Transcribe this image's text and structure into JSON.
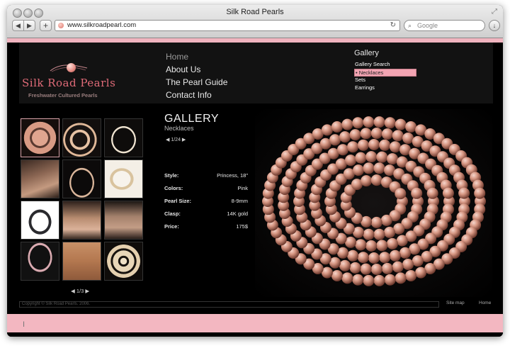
{
  "window": {
    "title": "Silk Road Pearls"
  },
  "browser": {
    "url": "www.silkroadpearl.com",
    "search_placeholder": "Google",
    "back_icon": "back-arrow-icon",
    "forward_icon": "forward-arrow-icon",
    "add_icon": "plus-icon",
    "reload_icon": "reload-icon"
  },
  "site": {
    "logo_text": "Silk Road Pearls",
    "tagline": "Freshwater Cultured Pearls",
    "nav": [
      {
        "label": "Home"
      },
      {
        "label": "About Us"
      },
      {
        "label": "The Pearl Guide"
      },
      {
        "label": "Contact Info"
      }
    ],
    "subnav": {
      "title": "Gallery",
      "items": [
        {
          "label": "Gallery Search"
        },
        {
          "label": "• Necklaces"
        },
        {
          "label": "Sets"
        },
        {
          "label": "Earrings"
        }
      ]
    }
  },
  "gallery": {
    "title": "GALLERY",
    "subtitle": "Necklaces",
    "counter": "1/24",
    "thumb_pager": "1/3",
    "specs": [
      {
        "label": "Style:",
        "value": "Princess, 18\""
      },
      {
        "label": "Colors:",
        "value": "Pink"
      },
      {
        "label": "Pearl Size:",
        "value": "8-9mm"
      },
      {
        "label": "Clasp:",
        "value": "14K gold"
      },
      {
        "label": "Price:",
        "value": "175$"
      }
    ]
  },
  "footer": {
    "copyright": "Copyright © Silk Road Pearls. 2006.",
    "site_map": "Site map",
    "home": "Home"
  },
  "colors": {
    "accent_pink": "#f0b4bf",
    "logo_pink": "#e06b78",
    "background": "#000000"
  }
}
